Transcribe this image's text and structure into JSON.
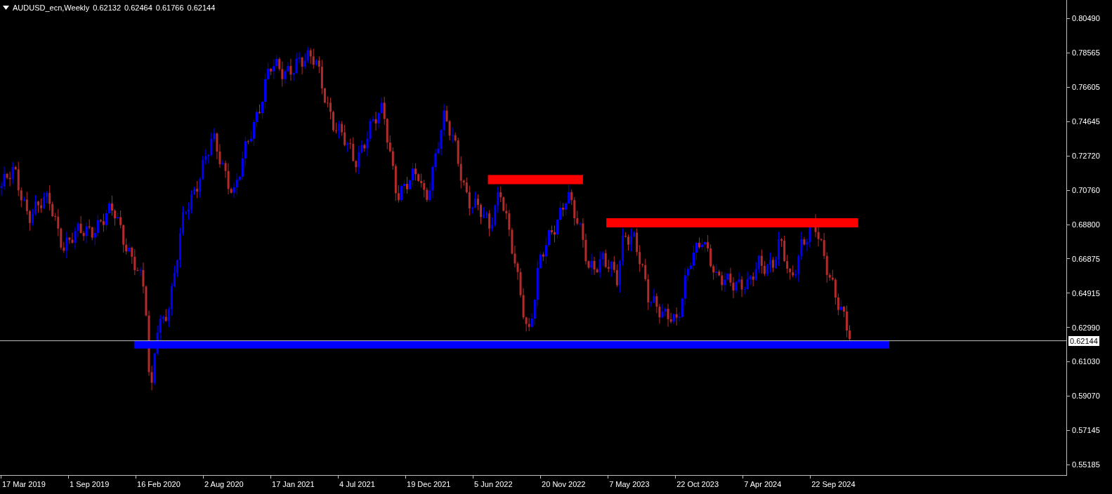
{
  "header": {
    "symbol": "AUDUSD_ecn,Weekly",
    "prices": [
      "0.62132",
      "0.62464",
      "0.61766",
      "0.62144"
    ]
  },
  "price_axis": {
    "ticks": [
      "0.80490",
      "0.78565",
      "0.76605",
      "0.74645",
      "0.72720",
      "0.70760",
      "0.68800",
      "0.66875",
      "0.64915",
      "0.62990",
      "0.61030",
      "0.59070",
      "0.57145",
      "0.55185"
    ],
    "current_price": "0.62144"
  },
  "time_axis": {
    "ticks": [
      "17 Mar 2019",
      "1 Sep 2019",
      "16 Feb 2020",
      "2 Aug 2020",
      "17 Jan 2021",
      "4 Jul 2021",
      "19 Dec 2021",
      "5 Jun 2022",
      "20 Nov 2022",
      "7 May 2023",
      "22 Oct 2023",
      "7 Apr 2024",
      "22 Sep 2024"
    ]
  }
}
